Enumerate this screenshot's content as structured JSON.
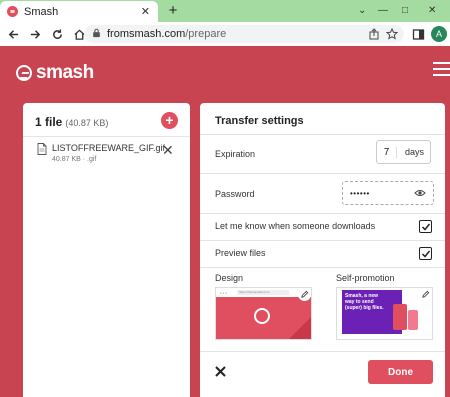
{
  "browser": {
    "tab_title": "Smash",
    "tab_close": "✕",
    "new_tab": "+",
    "url_domain": "fromsmash.com",
    "url_path": "/prepare",
    "profile_initial": "A",
    "window_controls": [
      "⌄",
      "—",
      "□",
      "✕"
    ]
  },
  "app": {
    "logo_text": "smash"
  },
  "files": {
    "count_label": "1 file",
    "total_size": "(40.87 KB)",
    "add_symbol": "+",
    "items": [
      {
        "name": "LISTOFFREEWARE_GIF.gif",
        "meta": "40.87 KB · .gif",
        "remove": "✕"
      }
    ]
  },
  "settings": {
    "title": "Transfer settings",
    "expiration_label": "Expiration",
    "expiration_value": "7",
    "expiration_unit": "days",
    "password_label": "Password",
    "password_value": "••••••",
    "notify_label": "Let me know when someone downloads",
    "notify_checked": true,
    "preview_label": "Preview files",
    "preview_checked": true,
    "design_label": "Design",
    "design_mini_url": "https://fromsmash.com",
    "promo_label": "Self-promotion",
    "promo_text": "Smash, a new way to send (super) big files.",
    "done_label": "Done"
  },
  "colors": {
    "brand": "#e04f5f",
    "background": "#c94451",
    "tabbar": "#a4dba0",
    "promo_purple": "#6b21b6"
  },
  "icons": [
    "back-icon",
    "forward-icon",
    "reload-icon",
    "home-icon",
    "lock-icon",
    "share-icon",
    "star-icon",
    "puzzle-icon",
    "sidebar-icon",
    "menu-dots-icon",
    "file-icon",
    "eye-icon",
    "check-icon",
    "pencil-icon",
    "close-icon",
    "hamburger-icon"
  ]
}
